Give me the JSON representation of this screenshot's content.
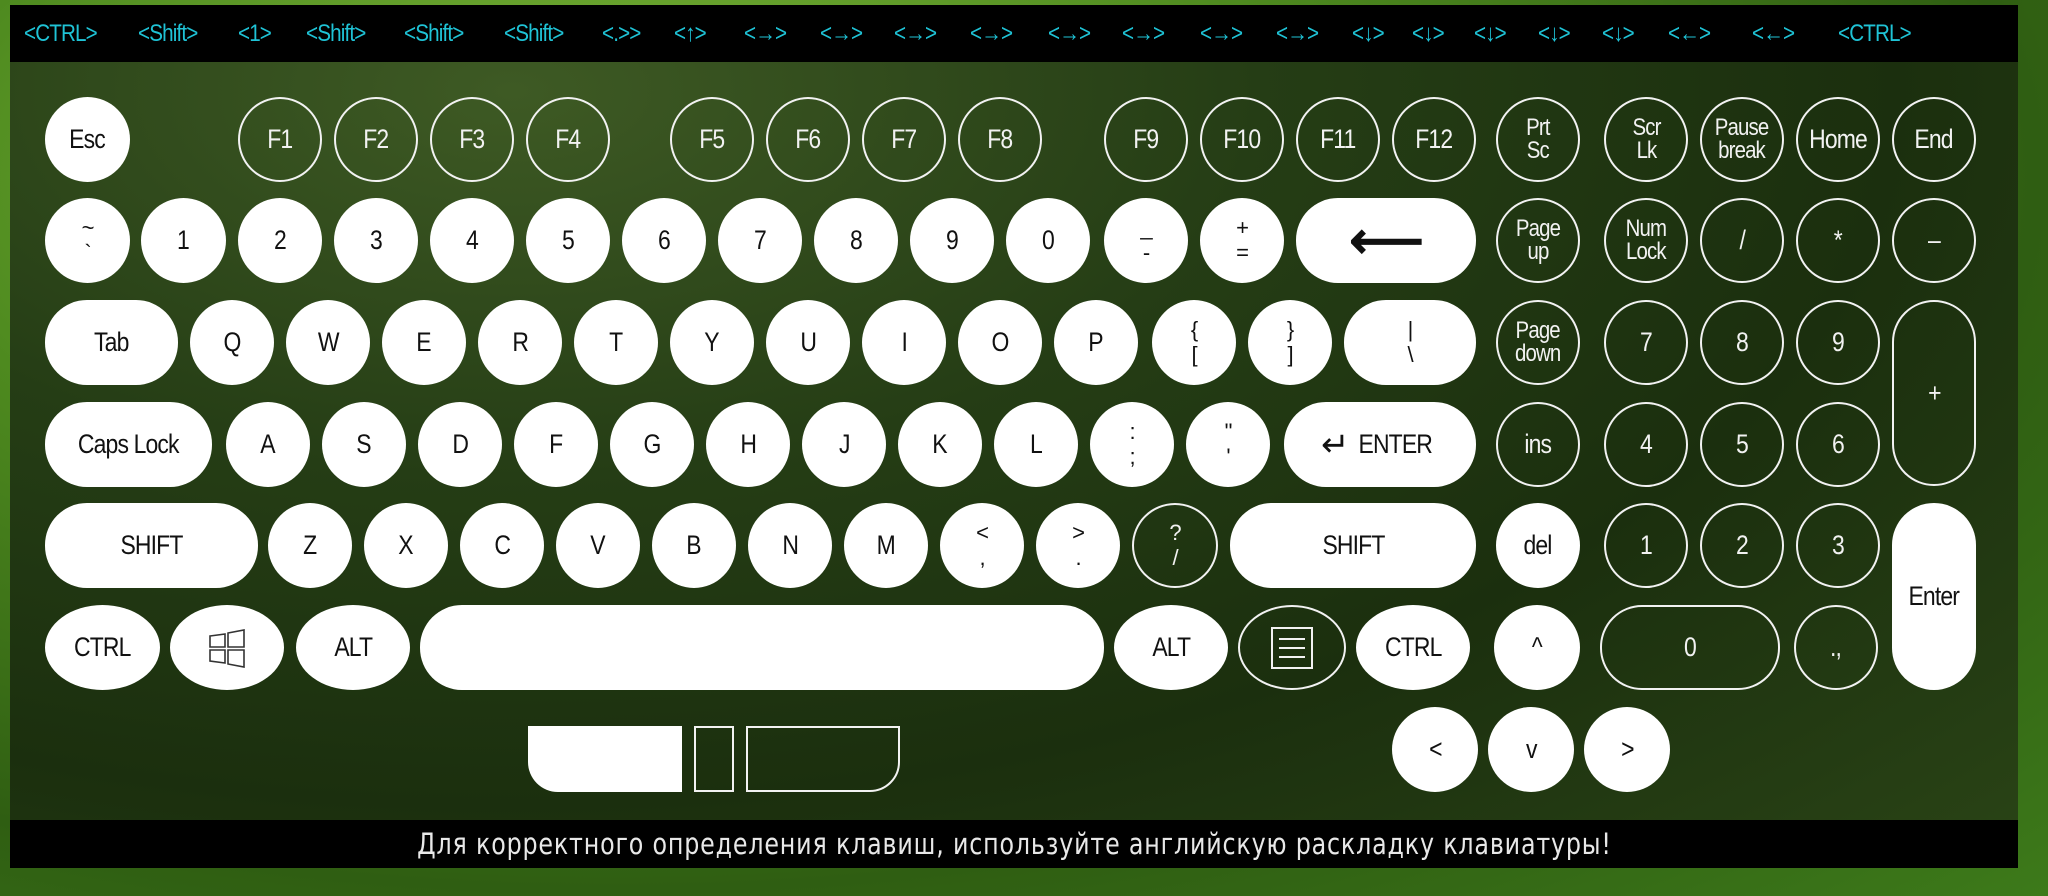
{
  "log_bar": {
    "entries": [
      "<CTRL>",
      "<Shift>",
      "<1>",
      "<Shift>",
      "<Shift>",
      "<Shift>",
      "<.>>",
      "<↑>",
      "<→>",
      "<→>",
      "<→>",
      "<→>",
      "<→>",
      "<→>",
      "<→>",
      "<→>",
      "<↓>",
      "<↓>",
      "<↓>",
      "<↓>",
      "<↓>",
      "<←>",
      "<←>",
      "<CTRL>"
    ]
  },
  "colors": {
    "log_text": "#1fc3d6",
    "key_pressed_fill": "#ffffff",
    "key_idle_outline": "#f2f2f2",
    "panel_bg": "#1b2f0e"
  },
  "keys": {
    "esc": {
      "label": "Esc",
      "pressed": true
    },
    "f1": {
      "label": "F1",
      "pressed": false
    },
    "f2": {
      "label": "F2",
      "pressed": false
    },
    "f3": {
      "label": "F3",
      "pressed": false
    },
    "f4": {
      "label": "F4",
      "pressed": false
    },
    "f5": {
      "label": "F5",
      "pressed": false
    },
    "f6": {
      "label": "F6",
      "pressed": false
    },
    "f7": {
      "label": "F7",
      "pressed": false
    },
    "f8": {
      "label": "F8",
      "pressed": false
    },
    "f9": {
      "label": "F9",
      "pressed": false
    },
    "f10": {
      "label": "F10",
      "pressed": false
    },
    "f11": {
      "label": "F11",
      "pressed": false
    },
    "f12": {
      "label": "F12",
      "pressed": false
    },
    "prtsc": {
      "line1": "Prt",
      "line2": "Sc",
      "pressed": false
    },
    "scrlk": {
      "line1": "Scr",
      "line2": "Lk",
      "pressed": false
    },
    "pause": {
      "line1": "Pause",
      "line2": "break",
      "pressed": false
    },
    "home": {
      "label": "Home",
      "pressed": false
    },
    "end": {
      "label": "End",
      "pressed": false
    },
    "tilde": {
      "top": "~",
      "bot": "`",
      "pressed": true
    },
    "d1": {
      "label": "1",
      "pressed": true
    },
    "d2": {
      "label": "2",
      "pressed": true
    },
    "d3": {
      "label": "3",
      "pressed": true
    },
    "d4": {
      "label": "4",
      "pressed": true
    },
    "d5": {
      "label": "5",
      "pressed": true
    },
    "d6": {
      "label": "6",
      "pressed": true
    },
    "d7": {
      "label": "7",
      "pressed": true
    },
    "d8": {
      "label": "8",
      "pressed": true
    },
    "d9": {
      "label": "9",
      "pressed": true
    },
    "d0": {
      "label": "0",
      "pressed": true
    },
    "minus": {
      "top": "_",
      "bot": "-",
      "pressed": true
    },
    "equals": {
      "top": "+",
      "bot": "=",
      "pressed": true
    },
    "backspace": {
      "label": "⟵",
      "pressed": true
    },
    "pageup": {
      "line1": "Page",
      "line2": "up",
      "pressed": false
    },
    "numlock": {
      "line1": "Num",
      "line2": "Lock",
      "pressed": false
    },
    "np_div": {
      "label": "/",
      "pressed": false
    },
    "np_mul": {
      "label": "*",
      "pressed": false
    },
    "np_sub": {
      "label": "–",
      "pressed": false
    },
    "tab": {
      "label": "Tab",
      "pressed": true
    },
    "q": {
      "label": "Q",
      "pressed": true
    },
    "w": {
      "label": "W",
      "pressed": true
    },
    "e": {
      "label": "E",
      "pressed": true
    },
    "r": {
      "label": "R",
      "pressed": true
    },
    "t": {
      "label": "T",
      "pressed": true
    },
    "y": {
      "label": "Y",
      "pressed": true
    },
    "u": {
      "label": "U",
      "pressed": true
    },
    "i": {
      "label": "I",
      "pressed": true
    },
    "o": {
      "label": "O",
      "pressed": true
    },
    "p": {
      "label": "P",
      "pressed": true
    },
    "lbracket": {
      "top": "{",
      "bot": "[",
      "pressed": true
    },
    "rbracket": {
      "top": "}",
      "bot": "]",
      "pressed": true
    },
    "backslash": {
      "top": "|",
      "bot": "\\",
      "pressed": true
    },
    "pagedown": {
      "line1": "Page",
      "line2": "down",
      "pressed": false
    },
    "np7": {
      "label": "7",
      "pressed": false
    },
    "np8": {
      "label": "8",
      "pressed": false
    },
    "np9": {
      "label": "9",
      "pressed": false
    },
    "np_add": {
      "label": "+",
      "pressed": false
    },
    "caps": {
      "label": "Caps Lock",
      "pressed": true
    },
    "a": {
      "label": "A",
      "pressed": true
    },
    "s": {
      "label": "S",
      "pressed": true
    },
    "d": {
      "label": "D",
      "pressed": true
    },
    "f": {
      "label": "F",
      "pressed": true
    },
    "g": {
      "label": "G",
      "pressed": true
    },
    "h": {
      "label": "H",
      "pressed": true
    },
    "j": {
      "label": "J",
      "pressed": true
    },
    "k": {
      "label": "K",
      "pressed": true
    },
    "l": {
      "label": "L",
      "pressed": true
    },
    "semicolon": {
      "top": ":",
      "bot": ";",
      "pressed": true
    },
    "quote": {
      "top": "\"",
      "bot": "'",
      "pressed": true
    },
    "enter": {
      "icon": "↵",
      "label": "ENTER",
      "pressed": true
    },
    "ins": {
      "label": "ins",
      "pressed": false
    },
    "np4": {
      "label": "4",
      "pressed": false
    },
    "np5": {
      "label": "5",
      "pressed": false
    },
    "np6": {
      "label": "6",
      "pressed": false
    },
    "lshift": {
      "label": "SHIFT",
      "pressed": true
    },
    "z": {
      "label": "Z",
      "pressed": true
    },
    "x": {
      "label": "X",
      "pressed": true
    },
    "c": {
      "label": "C",
      "pressed": true
    },
    "v": {
      "label": "V",
      "pressed": true
    },
    "b": {
      "label": "B",
      "pressed": true
    },
    "n": {
      "label": "N",
      "pressed": true
    },
    "m": {
      "label": "M",
      "pressed": true
    },
    "comma": {
      "top": "<",
      "bot": ",",
      "pressed": true
    },
    "period": {
      "top": ">",
      "bot": ".",
      "pressed": true
    },
    "slash": {
      "top": "?",
      "bot": "/",
      "pressed": false
    },
    "rshift": {
      "label": "SHIFT",
      "pressed": true
    },
    "del": {
      "label": "del",
      "pressed": true
    },
    "np1": {
      "label": "1",
      "pressed": false
    },
    "np2": {
      "label": "2",
      "pressed": false
    },
    "np3": {
      "label": "3",
      "pressed": false
    },
    "np_enter": {
      "label": "Enter",
      "pressed": true
    },
    "lctrl": {
      "label": "CTRL",
      "pressed": true
    },
    "win": {
      "icon": "windows-logo",
      "pressed": true
    },
    "lalt": {
      "label": "ALT",
      "pressed": true
    },
    "space": {
      "label": "",
      "pressed": true
    },
    "ralt": {
      "label": "ALT",
      "pressed": true
    },
    "menu": {
      "icon": "context-menu",
      "pressed": false
    },
    "rctrl": {
      "label": "CTRL",
      "pressed": true
    },
    "up": {
      "label": "^",
      "pressed": true
    },
    "np0": {
      "label": "0",
      "pressed": false
    },
    "np_dec": {
      "label": ".,",
      "pressed": false
    },
    "left": {
      "label": "<",
      "pressed": true
    },
    "down": {
      "label": "v",
      "pressed": true
    },
    "right": {
      "label": ">",
      "pressed": true
    }
  },
  "mouse": {
    "left_button": {
      "pressed": true
    },
    "middle_button": {
      "pressed": false
    },
    "right_button": {
      "pressed": false
    }
  },
  "footer": {
    "message": "Для корректного определения клавиш, используйте английскую раскладку клавиатуры!"
  }
}
